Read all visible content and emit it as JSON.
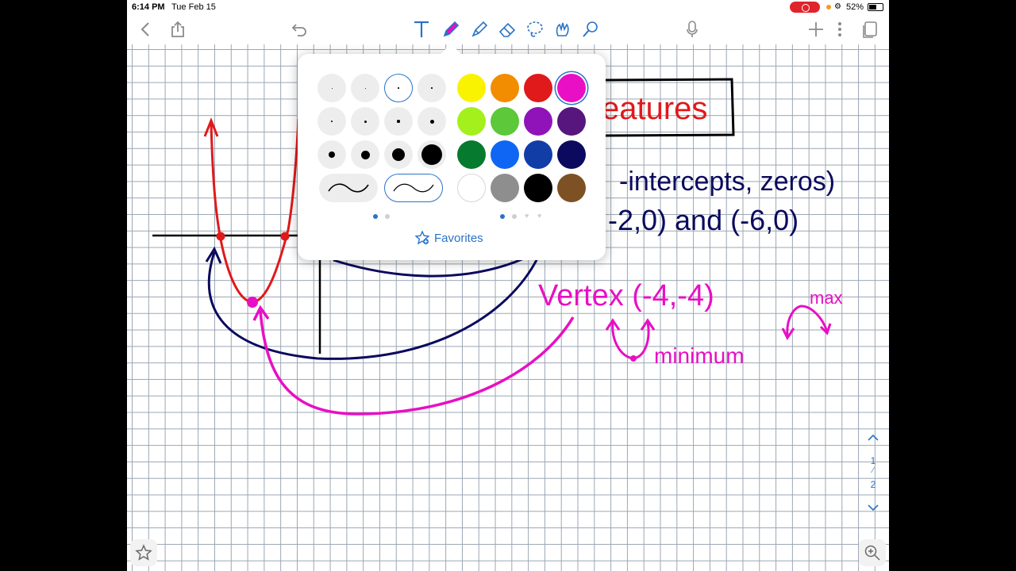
{
  "status_bar": {
    "time": "6:14 PM",
    "date": "Tue Feb 15",
    "battery_percent": "52%",
    "recording": true
  },
  "toolbar": {
    "left_items": [
      {
        "icon": "chevron-left-icon"
      },
      {
        "icon": "share-icon"
      },
      {
        "icon": "undo-icon"
      }
    ],
    "tools": [
      {
        "icon": "text-tool-icon",
        "selected": false
      },
      {
        "icon": "pen-tool-icon",
        "selected": true
      },
      {
        "icon": "highlighter-tool-icon",
        "selected": false
      },
      {
        "icon": "eraser-tool-icon",
        "selected": false
      },
      {
        "icon": "lasso-tool-icon",
        "selected": false
      },
      {
        "icon": "shape-tool-icon",
        "selected": false
      },
      {
        "icon": "laser-pointer-icon",
        "selected": false
      }
    ],
    "right_items": [
      {
        "icon": "microphone-icon"
      },
      {
        "icon": "plus-icon"
      },
      {
        "icon": "more-icon"
      },
      {
        "icon": "pages-icon"
      }
    ]
  },
  "pen_popup": {
    "pen_sizes": [
      {
        "dot": 1,
        "selected": false
      },
      {
        "dot": 1,
        "selected": false
      },
      {
        "dot": 1.5,
        "selected": true
      },
      {
        "dot": 1.5,
        "selected": false
      },
      {
        "dot": 2.5,
        "selected": false
      },
      {
        "dot": 3,
        "selected": false
      },
      {
        "dot": 3.5,
        "selected": false
      },
      {
        "dot": 5,
        "selected": false
      },
      {
        "dot": 8,
        "selected": false
      },
      {
        "dot": 11,
        "selected": false
      },
      {
        "dot": 16,
        "selected": false
      },
      {
        "dot": 26,
        "selected": false
      }
    ],
    "stroke_styles": [
      {
        "name": "ballpoint",
        "selected": false
      },
      {
        "name": "fountain",
        "selected": true
      }
    ],
    "colors": [
      "#f9f200",
      "#f28c00",
      "#e0191b",
      "#e80fc4",
      "#a3f01c",
      "#5cc83a",
      "#8f13b8",
      "#56167e",
      "#067a2e",
      "#0f66f5",
      "#113da6",
      "#0b0a5e",
      "#ffffff",
      "#8e8e8e",
      "#000000",
      "#7e5124"
    ],
    "selected_color": "#e80fc4",
    "favorites_label": "Favorites"
  },
  "pager": {
    "current": "1",
    "total": "2"
  },
  "accent_color": "#2a73c8"
}
